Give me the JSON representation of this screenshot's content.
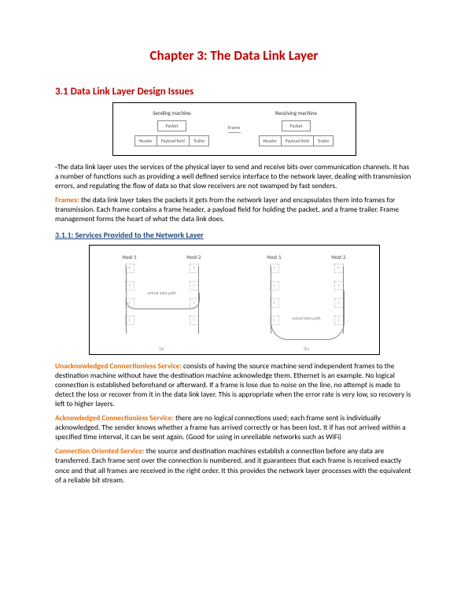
{
  "title": "Chapter 3: The Data Link Layer",
  "section1": "3.1 Data Link Layer Design Issues",
  "fig1": {
    "sending": "Sending machine",
    "receiving": "Receiving machine",
    "packet": "Packet",
    "header": "Header",
    "payload": "Payload field",
    "trailer": "Trailer",
    "frame": "Frame"
  },
  "p1": "-The data link layer uses the services of the physical layer to send and receive bits over communication channels. It has a number of functions such as providing a well defined service interface to the network layer, dealing with transmission errors, and regulating the flow of data so that slow receivers are not swamped by fast senders.",
  "frames_term": "Frames:",
  "frames_text": " the data link layer takes the packets it gets from the network layer and encapsulates them into frames for transmission. Each frame contains a frame header, a payload field for holding the packet, and a frame trailer. Frame management forms the heart of what the data link does.",
  "subsection": "3.1.1: Services Provided to the Network Layer",
  "fig2": {
    "host1": "Host 1",
    "host2": "Host 2",
    "virtual": "virtual\ndata path",
    "actual": "actual\ndata path",
    "a": "(a)",
    "b": "(b)"
  },
  "uc_term": "Unacknowledged Connectionless Service:",
  "uc_text": " consists of having the source machine send independent frames to the destination machine without have the destination machine acknowledge them. Ethernet is an example. No logical connection is established beforehand or afterward. If a frame is lose due to noise on the line, no attempt is made to detect the loss or recover from it in the data link layer. This is appropriate when the error rate is very low, so recovery is left to higher layers.",
  "ac_term": "Acknowledged Connectionless Service:",
  "ac_text": " there are no logical connections used; each frame sent is individually acknowledged. The sender knows whether a frame has arrived correctly or has been lost. It if has not arrived within a specified time interval, it can be sent again. (Good for using in unreliable networks such as WiFi)",
  "co_term": "Connection Oriented Service:",
  "co_text": " the source and destination machines establish a connection before any data are transferred. Each frame sent over the connection is numbered, and it guarantees that each frame is received exactly once and that all frames are received in the right order. It this provides the network layer processes with the equivalent of a reliable bit stream."
}
